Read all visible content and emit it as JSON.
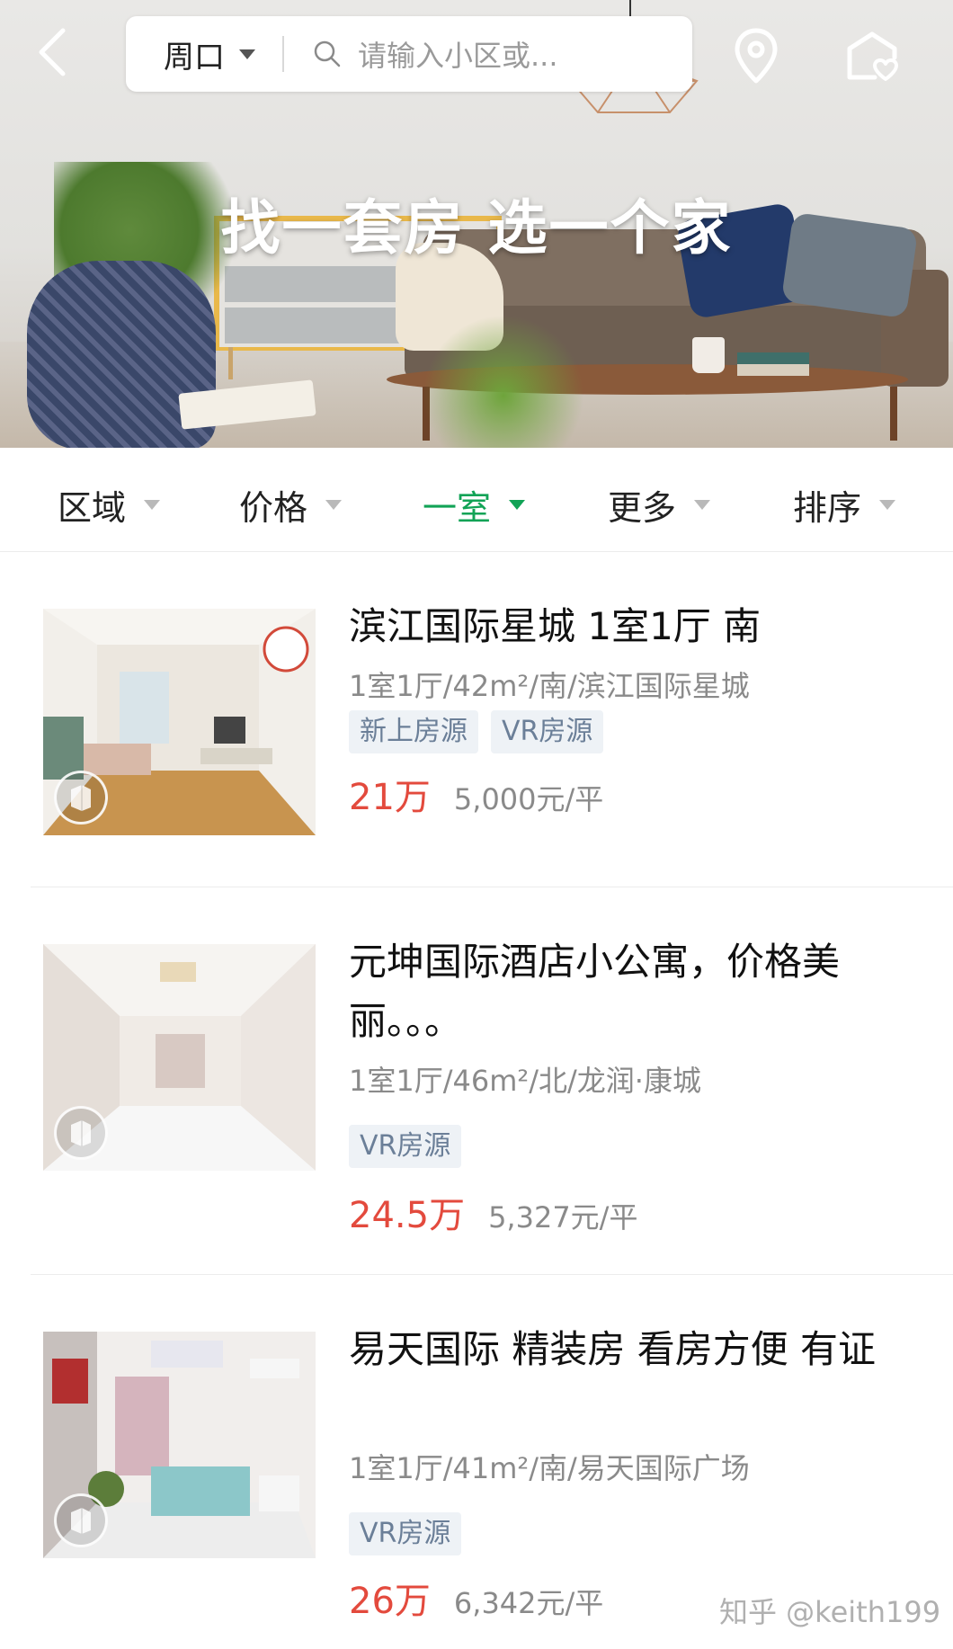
{
  "header": {
    "city": "周口",
    "search_placeholder": "请输入小区或...",
    "icons": {
      "back": "back-arrow-icon",
      "location": "location-pin-icon",
      "favorites": "house-heart-icon",
      "search": "search-icon"
    }
  },
  "banner": {
    "slogan": "找一套房 选一个家"
  },
  "filters": [
    {
      "label": "区域",
      "active": false
    },
    {
      "label": "价格",
      "active": false
    },
    {
      "label": "一室",
      "active": true
    },
    {
      "label": "更多",
      "active": false
    },
    {
      "label": "排序",
      "active": false
    }
  ],
  "colors": {
    "accent": "#12a356",
    "price": "#e34a3d",
    "tag_text": "#6b7f98",
    "tag_bg": "#eef2f6"
  },
  "listings": [
    {
      "title": "滨江国际星城 1室1厅 南",
      "meta": "1室1厅/42m²/南/滨江国际星城",
      "tags": [
        "新上房源",
        "VR房源"
      ],
      "price": "21万",
      "unit_price": "5,000元/平"
    },
    {
      "title": "元坤国际酒店小公寓，价格美丽。。。",
      "meta": "1室1厅/46m²/北/龙润·康城",
      "tags": [
        "VR房源"
      ],
      "price": "24.5万",
      "unit_price": "5,327元/平"
    },
    {
      "title": "易天国际 精装房 看房方便 有证",
      "meta": "1室1厅/41m²/南/易天国际广场",
      "tags": [
        "VR房源"
      ],
      "price": "26万",
      "unit_price": "6,342元/平"
    }
  ],
  "watermark": "知乎 @keith199"
}
